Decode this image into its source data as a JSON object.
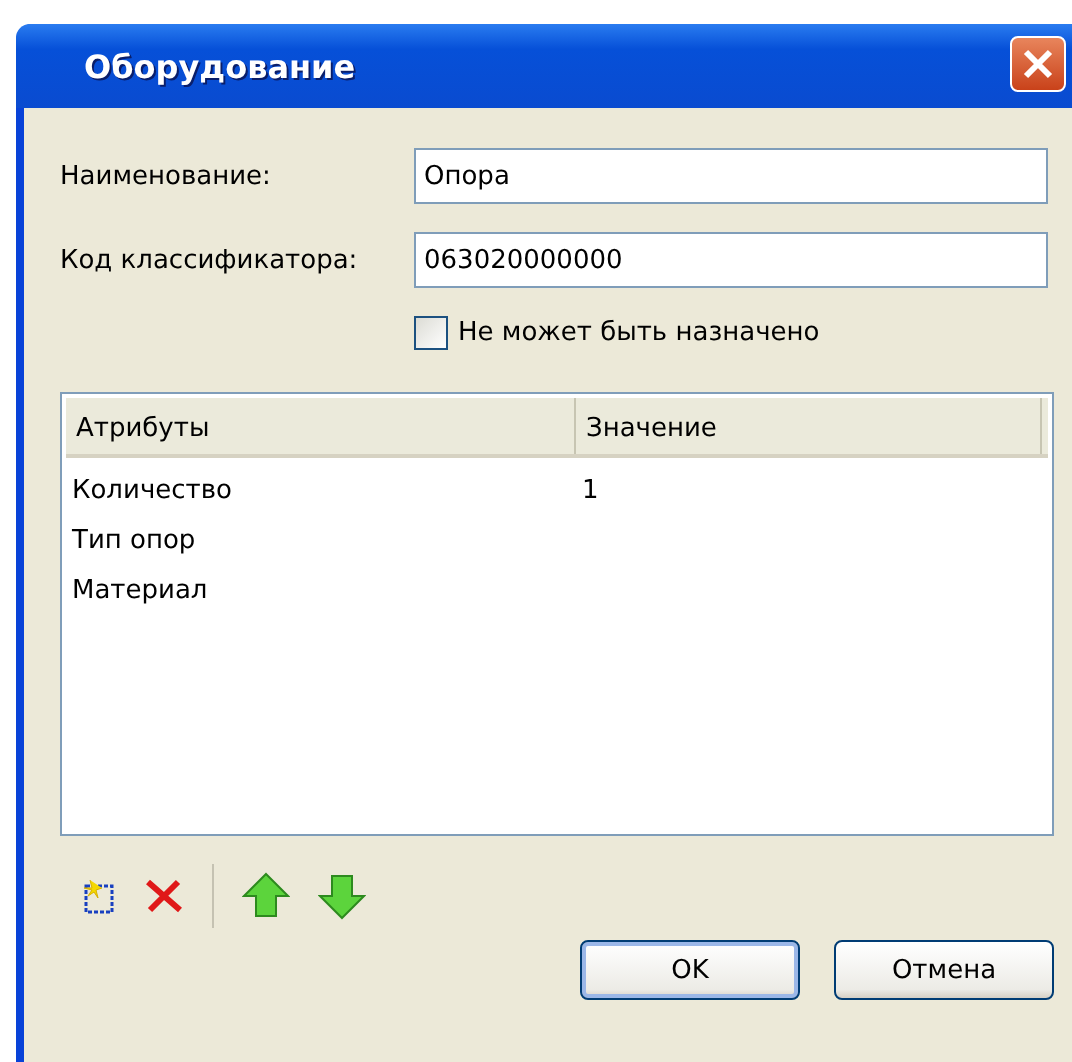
{
  "window": {
    "title": "Оборудование"
  },
  "fields": [
    {
      "label": "Наименование:",
      "value": "Опора"
    },
    {
      "label": "Код классификатора:",
      "value": "063020000000"
    }
  ],
  "checkbox": {
    "label": "Не может быть назначено",
    "checked": false
  },
  "table": {
    "columns": [
      "Атрибуты",
      "Значение"
    ],
    "rows": [
      {
        "cells": [
          "Количество",
          "1"
        ]
      },
      {
        "cells": [
          "Тип опор",
          ""
        ]
      },
      {
        "cells": [
          "Материал",
          ""
        ]
      }
    ]
  },
  "buttons": [
    "OK",
    "Отмена"
  ]
}
